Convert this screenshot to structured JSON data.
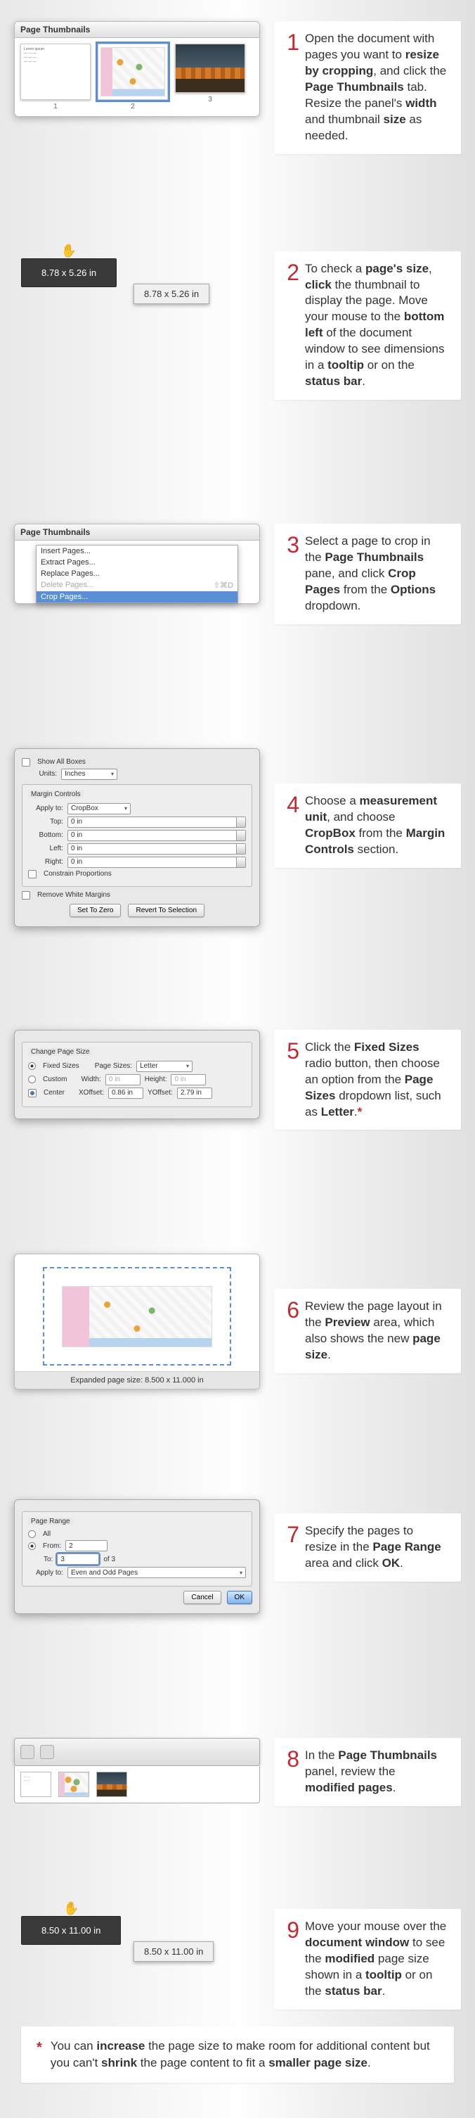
{
  "steps": [
    {
      "num": "1",
      "html": "Open the document with pages you want to <b>resize by cropping</b>, and click the <b>Page Thumbnails</b> tab. Resize the panel's <b>width</b> and thumbnail <b>size</b> as needed."
    },
    {
      "num": "2",
      "html": "To check a <b>page's size</b>, <b>click</b> the thumbnail to display the page. Move your mouse to the <b>bottom left</b> of the document window to see dimensions in a <b>tooltip</b> or on the <b>status bar</b>."
    },
    {
      "num": "3",
      "html": "Select a page to crop in the <b>Page Thumbnails</b> pane, and click <b>Crop Pages</b> from the <b>Options</b> dropdown."
    },
    {
      "num": "4",
      "html": "Choose a <b>measurement unit</b>, and choose <b>CropBox</b> from the <b>Margin Controls</b> section."
    },
    {
      "num": "5",
      "html": "Click the <b>Fixed Sizes</b> radio button, then choose an option from the <b>Page Sizes</b> dropdown list, such as <b>Letter</b>.<span class='star'>*</span>"
    },
    {
      "num": "6",
      "html": " Review the page layout in the <b>Preview</b> area, which also shows the new <b>page size</b>."
    },
    {
      "num": "7",
      "html": "Specify the pages to resize in the <b>Page Range</b> area and click <b>OK</b>."
    },
    {
      "num": "8",
      "html": "In the <b>Page Thumbnails</b> panel, review the <b>modified pages</b>."
    },
    {
      "num": "9",
      "html": "Move your mouse over the <b>document window</b> to see the <b>modified</b> page size shown in a <b>tooltip</b> or on the <b>status bar</b>."
    }
  ],
  "footnote": {
    "mark": "*",
    "html": "You can <b>increase</b> the page size to make room for additional content but you can't <b>shrink</b> the page content to fit a <b>smaller page size</b>."
  },
  "panel1": {
    "title": "Page Thumbnails",
    "thumbs": [
      {
        "label": "1"
      },
      {
        "label": "2",
        "selected": true
      },
      {
        "label": "3"
      }
    ]
  },
  "size2": {
    "tooltip": "8.78 x 5.26 in",
    "status": "8.78 x 5.26 in"
  },
  "panel3": {
    "title": "Page Thumbnails",
    "menu": [
      {
        "label": "Insert Pages..."
      },
      {
        "label": "Extract Pages..."
      },
      {
        "label": "Replace Pages..."
      },
      {
        "label": "Delete Pages...",
        "disabled": true,
        "shortcut": "⇧⌘D"
      },
      {
        "label": "Crop Pages...",
        "hover": true
      }
    ]
  },
  "dialog4": {
    "show_all": "Show All Boxes",
    "units_lbl": "Units:",
    "units_val": "Inches",
    "group": "Margin Controls",
    "apply_lbl": "Apply to:",
    "apply_val": "CropBox",
    "fields": [
      {
        "lbl": "Top:",
        "val": "0 in"
      },
      {
        "lbl": "Bottom:",
        "val": "0 in"
      },
      {
        "lbl": "Left:",
        "val": "0 in"
      },
      {
        "lbl": "Right:",
        "val": "0 in"
      }
    ],
    "constrain": "Constrain Proportions",
    "remove": "Remove White Margins",
    "btn_zero": "Set To Zero",
    "btn_revert": "Revert To Selection"
  },
  "dialog5": {
    "group": "Change Page Size",
    "fixed": "Fixed Sizes",
    "pagesizes_lbl": "Page Sizes:",
    "pagesizes_val": "Letter",
    "custom": "Custom",
    "width_lbl": "Width:",
    "width_val": "0 in",
    "height_lbl": "Height:",
    "height_val": "0 in",
    "center": "Center",
    "xoff_lbl": "XOffset:",
    "xoff_val": "0.86 in",
    "yoff_lbl": "YOffset:",
    "yoff_val": "2.79 in"
  },
  "preview6": {
    "caption": "Expanded page size: 8.500 x 11.000 in"
  },
  "dialog7": {
    "group": "Page Range",
    "all": "All",
    "from_lbl": "From:",
    "from_val": "2",
    "to_lbl": "To:",
    "to_val": "3",
    "of": "of 3",
    "apply_lbl": "Apply to:",
    "apply_val": "Even and Odd Pages",
    "cancel": "Cancel",
    "ok": "OK"
  },
  "size9": {
    "tooltip": "8.50 x 11.00 in",
    "status": "8.50 x 11.00 in"
  }
}
